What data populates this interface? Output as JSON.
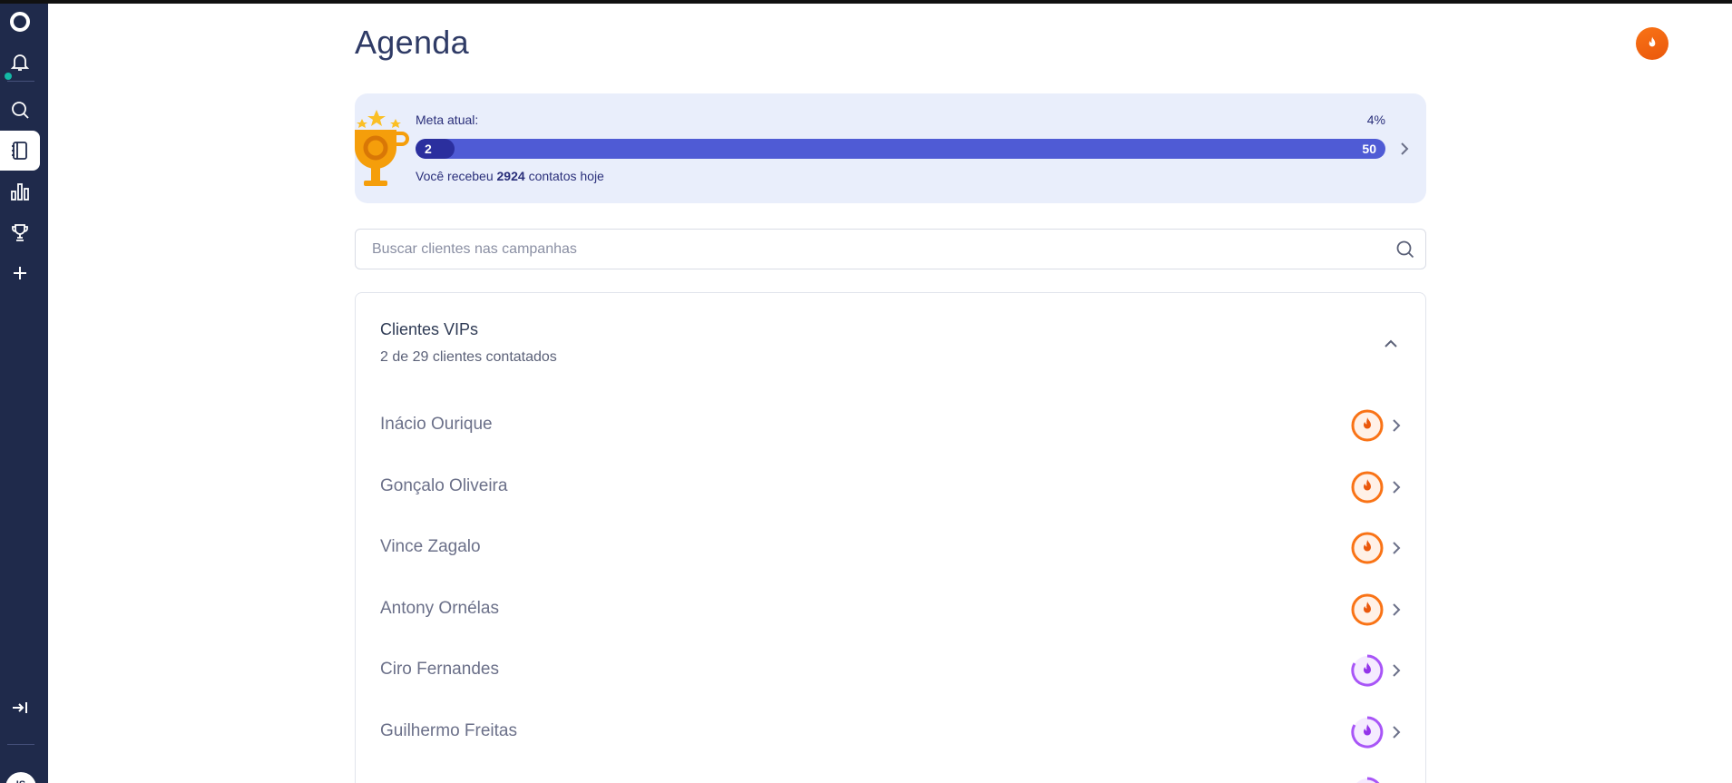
{
  "sidebar": {
    "items": [
      {
        "name": "logo-icon"
      },
      {
        "name": "bell-icon"
      },
      {
        "name": "search-icon"
      },
      {
        "name": "agenda-icon"
      },
      {
        "name": "chart-icon"
      },
      {
        "name": "trophy-icon"
      },
      {
        "name": "plus-icon"
      },
      {
        "name": "collapse-icon"
      }
    ],
    "avatar_initials": "IS"
  },
  "header": {
    "title": "Agenda"
  },
  "goal": {
    "label": "Meta atual:",
    "percent": "4%",
    "current": "2",
    "target": "50",
    "progress_fraction": 0.04,
    "received_prefix": "Você recebeu",
    "received_count": "2924",
    "received_suffix": "contatos hoje"
  },
  "search": {
    "placeholder": "Buscar clientes nas campanhas"
  },
  "campaign": {
    "title": "Clientes VIPs",
    "subtitle": "2 de 29 clientes contatados",
    "clients": [
      {
        "name": "Inácio Ourique",
        "badge": "hot"
      },
      {
        "name": "Gonçalo Oliveira",
        "badge": "hot"
      },
      {
        "name": "Vince Zagalo",
        "badge": "hot"
      },
      {
        "name": "Antony Ornélas",
        "badge": "hot"
      },
      {
        "name": "Ciro Fernandes",
        "badge": "warm"
      },
      {
        "name": "Guilhermo Freitas",
        "badge": "warm"
      }
    ]
  },
  "colors": {
    "sidebar": "#1f2a4b",
    "accent": "#4f5bd5",
    "hot": "#f97316",
    "warm": "#a855f7"
  }
}
